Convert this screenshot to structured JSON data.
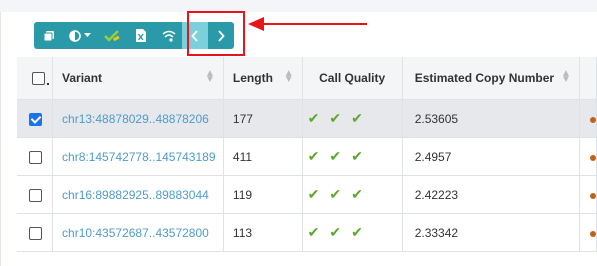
{
  "toolbar": {
    "buttons": [
      {
        "icon": "copy-icon"
      },
      {
        "icon": "contrast-dropdown-icon"
      },
      {
        "icon": "checkmark-edit-icon"
      },
      {
        "icon": "excel-export-icon"
      },
      {
        "icon": "signal-icon"
      },
      {
        "icon": "chevron-left-icon"
      },
      {
        "icon": "chevron-right-icon"
      }
    ],
    "accent": "#2a9aa8",
    "disabled_accent": "#7cd0dc"
  },
  "annotation": {
    "color": "#e8141c"
  },
  "table": {
    "columns": [
      "Variant",
      "Length",
      "Call Quality",
      "Estimated Copy Number"
    ],
    "rows": [
      {
        "variant": "chr13:48878029..48878206",
        "length": "177",
        "quality": [
          "✔",
          "✔",
          "✔"
        ],
        "copy_number": "2.53605",
        "selected": true
      },
      {
        "variant": "chr8:145742778..145743189",
        "length": "411",
        "quality": [
          "✔",
          "✔",
          "✔"
        ],
        "copy_number": "2.4957",
        "selected": false
      },
      {
        "variant": "chr16:89882925..89883044",
        "length": "119",
        "quality": [
          "✔",
          "✔",
          "✔"
        ],
        "copy_number": "2.42223",
        "selected": false
      },
      {
        "variant": "chr10:43572687..43572800",
        "length": "113",
        "quality": [
          "✔",
          "✔",
          "✔"
        ],
        "copy_number": "2.33342",
        "selected": false
      }
    ]
  }
}
